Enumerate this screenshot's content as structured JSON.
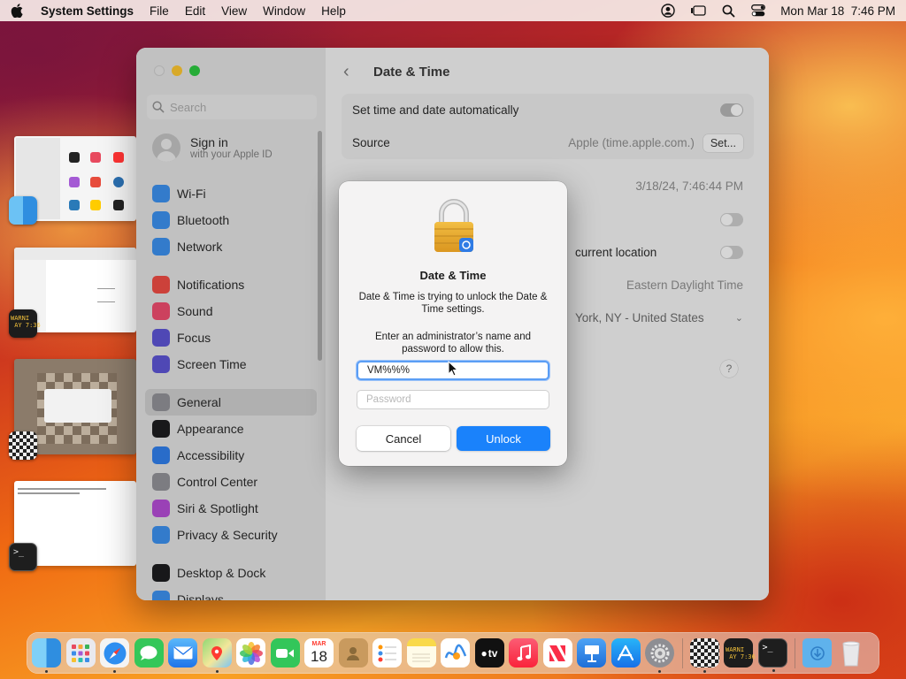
{
  "menubar": {
    "app_name": "System Settings",
    "menus": [
      "File",
      "Edit",
      "View",
      "Window",
      "Help"
    ],
    "datetime": "Mon Mar 18  7:46 PM"
  },
  "sidebar": {
    "search_placeholder": "Search",
    "account": {
      "name": "Sign in",
      "subtitle": "with your Apple ID"
    },
    "groups": [
      [
        {
          "label": "Wi-Fi",
          "icon": "wifi-icon",
          "color": "#3b8de8"
        },
        {
          "label": "Bluetooth",
          "icon": "bluetooth-icon",
          "color": "#3b8de8"
        },
        {
          "label": "Network",
          "icon": "globe-icon",
          "color": "#3b8de8"
        }
      ],
      [
        {
          "label": "Notifications",
          "icon": "bell-icon",
          "color": "#e94a43"
        },
        {
          "label": "Sound",
          "icon": "speaker-icon",
          "color": "#e94a6c"
        },
        {
          "label": "Focus",
          "icon": "moon-icon",
          "color": "#5b52cf"
        },
        {
          "label": "Screen Time",
          "icon": "hourglass-icon",
          "color": "#5b52cf"
        }
      ],
      [
        {
          "label": "General",
          "icon": "gear-icon",
          "color": "#8e8e93",
          "selected": true
        },
        {
          "label": "Appearance",
          "icon": "appearance-icon",
          "color": "#1c1c1e"
        },
        {
          "label": "Accessibility",
          "icon": "accessibility-icon",
          "color": "#2f7be5"
        },
        {
          "label": "Control Center",
          "icon": "control-center-icon",
          "color": "#8e8e93"
        },
        {
          "label": "Siri & Spotlight",
          "icon": "siri-icon",
          "color": "#b04ad0"
        },
        {
          "label": "Privacy & Security",
          "icon": "hand-icon",
          "color": "#3b8de8"
        }
      ],
      [
        {
          "label": "Desktop & Dock",
          "icon": "dock-icon",
          "color": "#1c1c1e"
        },
        {
          "label": "Displays",
          "icon": "display-icon",
          "color": "#3b8de8"
        }
      ]
    ]
  },
  "content": {
    "title": "Date & Time",
    "set_auto_label": "Set time and date automatically",
    "source_label": "Source",
    "source_value": "Apple (time.apple.com.)",
    "set_button": "Set...",
    "datetime_value": "3/18/24, 7:46:44 PM",
    "location_label": "current location",
    "timezone_value": "Eastern Daylight Time",
    "closest_city": "York, NY - United States",
    "help": "?"
  },
  "dialog": {
    "title": "Date & Time",
    "message": "Date & Time is trying to unlock the Date & Time settings.",
    "prompt": "Enter an administrator’s name and password to allow this.",
    "username_value": "VM%%%",
    "password_placeholder": "Password",
    "cancel_label": "Cancel",
    "unlock_label": "Unlock"
  },
  "stage": {
    "badge_text": "WARNI\n AY 7:36"
  },
  "dock": {
    "calendar_month": "MAR",
    "calendar_day": "18",
    "apps": [
      "Finder",
      "Launchpad",
      "Safari",
      "Messages",
      "Mail",
      "Maps",
      "Photos",
      "FaceTime",
      "Calendar",
      "Contacts",
      "Reminders",
      "Notes",
      "Freeform",
      "TV",
      "Music",
      "News",
      "Keynote",
      "App Store",
      "System Settings",
      "Chess",
      "Console",
      "Terminal",
      "Downloads",
      "Trash"
    ],
    "tv_label": "tv"
  },
  "colors": {
    "accent": "#1a82fb",
    "focus_ring": "#5b9ef5"
  }
}
